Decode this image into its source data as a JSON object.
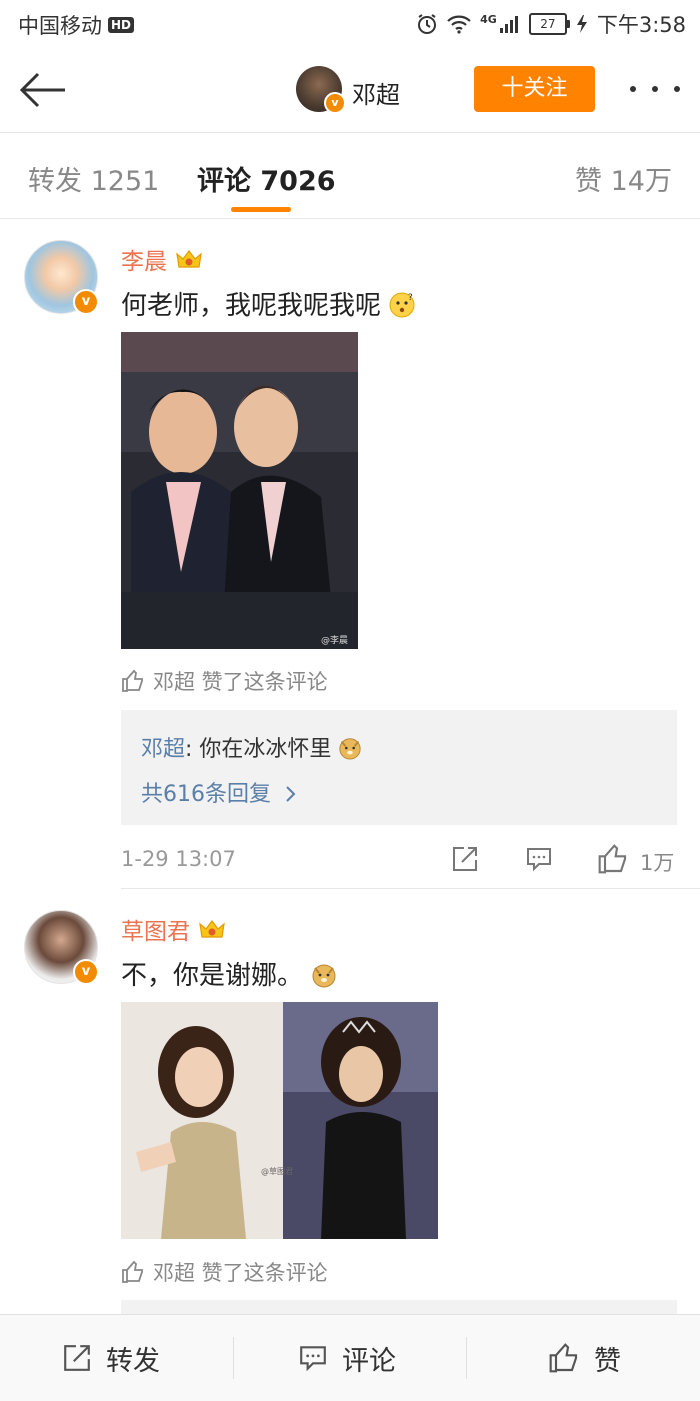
{
  "status_bar": {
    "carrier": "中国移动",
    "hd": "HD",
    "network": "4G",
    "battery": "27",
    "time": "下午3:58"
  },
  "nav": {
    "username": "邓超",
    "follow_label": "十关注"
  },
  "tabs": [
    {
      "label": "转发 1251",
      "active": false
    },
    {
      "label": "评论 7026",
      "active": true
    },
    {
      "label": "赞 14万",
      "active": false
    }
  ],
  "comments": [
    {
      "user": "李晨",
      "text": "何老师，我呢我呢我呢",
      "watermark": "@李晨",
      "liked_by": "邓超 赞了这条评论",
      "reply": {
        "user": "邓超",
        "text": ": 你在冰冰怀里",
        "count": "共616条回复"
      },
      "time": "1-29 13:07",
      "likes": "1万"
    },
    {
      "user": "草图君",
      "text": "不，你是谢娜。",
      "watermark": "@草图君",
      "liked_by": "邓超 赞了这条评论"
    }
  ],
  "bottom_bar": {
    "repost": "转发",
    "comment": "评论",
    "like": "赞"
  },
  "colors": {
    "accent": "#ff8200",
    "username": "#eb7350",
    "reply_link": "#5a7fa9",
    "verified": "#f38b00"
  }
}
